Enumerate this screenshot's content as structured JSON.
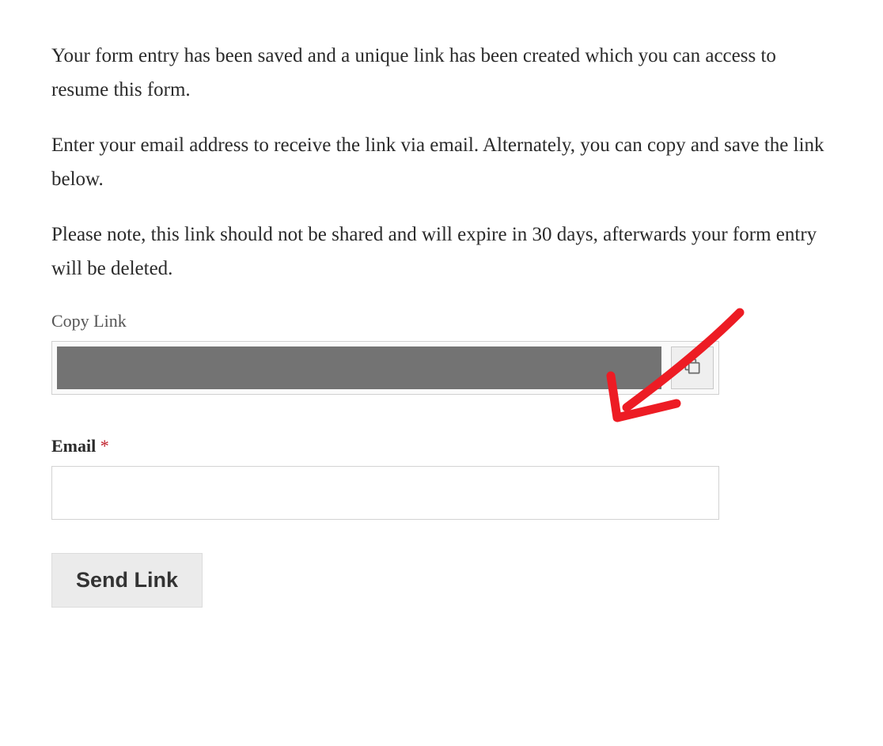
{
  "intro": {
    "paragraph1": "Your form entry has been saved and a unique link has been created which you can access to resume this form.",
    "paragraph2": "Enter your email address to receive the link via email. Alternately, you can copy and save the link below.",
    "paragraph3": "Please note, this link should not be shared and will expire in 30 days, afterwards your form entry will be deleted."
  },
  "fields": {
    "copy_link_label": "Copy Link",
    "copy_link_value": "",
    "email_label": "Email",
    "email_required_mark": "*",
    "email_value": ""
  },
  "buttons": {
    "send_link": "Send Link"
  },
  "annotation": {
    "arrow_color": "#ed1c24"
  }
}
